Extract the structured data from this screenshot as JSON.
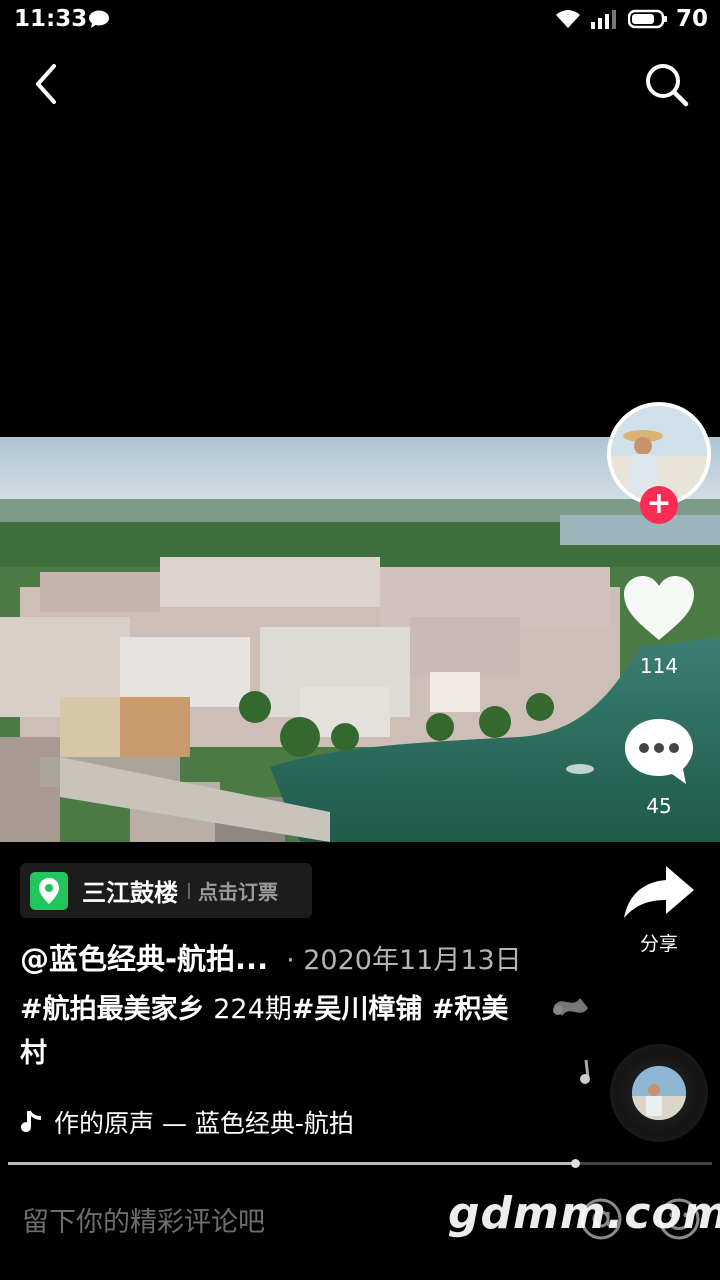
{
  "status_bar": {
    "time": "11:33",
    "network": "4G",
    "battery": "70"
  },
  "nav": {
    "back_icon": "chevron-left-icon",
    "search_icon": "search-icon"
  },
  "actions": {
    "like_count": "114",
    "comment_count": "45",
    "share_label": "分享",
    "follow_symbol": "+"
  },
  "location": {
    "name": "三江鼓楼",
    "action": "点击订票"
  },
  "post": {
    "author": "@蓝色经典-航拍...",
    "date": "· 2020年11月13日",
    "caption_tag1": "#航拍最美家乡",
    "caption_plain": " 224期",
    "caption_tag2": "#吴川樟铺 #积美村",
    "music": "作的原声 — 蓝色经典-航拍"
  },
  "playback": {
    "progress": 0.805
  },
  "comment_bar": {
    "placeholder": "留下你的精彩评论吧",
    "watermark": "gdmm.com"
  },
  "colors": {
    "follow_red": "#fe2c55",
    "location_green": "#22c55e",
    "water": "#2f6e5b"
  }
}
